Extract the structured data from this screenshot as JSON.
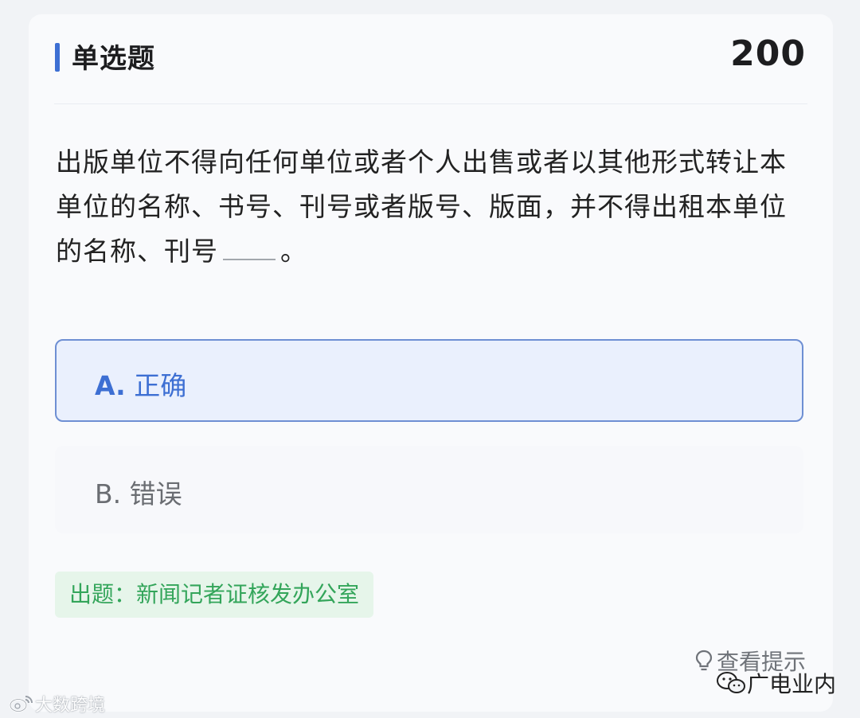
{
  "header": {
    "type_label": "单选题",
    "score": "200"
  },
  "question": {
    "text_before": "出版单位不得向任何单位或者个人出售或者以其他形式转让本单位的名称、书号、刊号或者版号、版面，并不得出租本单位的名称、刊号",
    "text_after": "。"
  },
  "options": [
    {
      "key": "A.",
      "label": "正确",
      "selected": true
    },
    {
      "key": "B.",
      "label": "错误",
      "selected": false
    }
  ],
  "source": "出题：新闻记者证核发办公室",
  "hint_label": "查看提示",
  "watermarks": {
    "left": "大数跨境",
    "right": "广电业内"
  },
  "colors": {
    "accent": "#3d6fd3",
    "selected_bg": "#eaf0fd",
    "source_green": "#33a55a"
  },
  "icons": [
    "lightbulb-icon",
    "weibo-icon",
    "wechat-icon"
  ]
}
